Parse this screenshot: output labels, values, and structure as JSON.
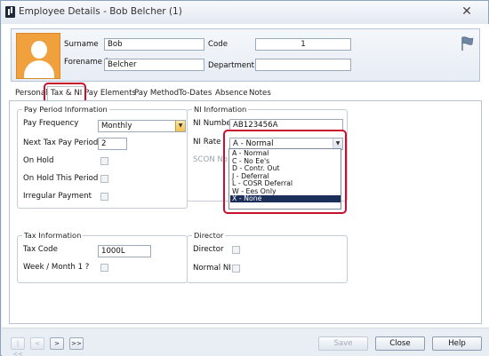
{
  "window": {
    "title": "Employee Details - Bob Belcher (1)",
    "close_glyph": "✕"
  },
  "header": {
    "surname_label": "Surname",
    "surname_value": "Bob",
    "forename_label": "Forename 1",
    "forename_value": "Belcher",
    "code_label": "Code",
    "code_value": "1",
    "department_label": "Department",
    "department_value": ""
  },
  "tabs": [
    "Personal",
    "Tax & NI",
    "Pay Elements",
    "Pay Method",
    "To-Dates",
    "Absence",
    "Notes"
  ],
  "pay_period": {
    "title": "Pay Period Information",
    "frequency_label": "Pay Frequency",
    "frequency_value": "Monthly",
    "next_period_label": "Next Tax Pay Period",
    "next_period_value": "2",
    "on_hold_label": "On Hold",
    "on_hold_period_label": "On Hold This Period",
    "irregular_label": "Irregular Payment"
  },
  "tax": {
    "title": "Tax Information",
    "code_label": "Tax Code",
    "code_value": "1000L",
    "week_month_label": "Week / Month 1 ?"
  },
  "ni": {
    "title": "NI Information",
    "number_label": "NI Number",
    "number_value": "AB123456A",
    "rate_label": "NI Rate",
    "rate_value": "A - Normal",
    "scon_label": "SCON No",
    "options": [
      "A - Normal",
      "C - No Ee's",
      "D - Contr. Out",
      "J - Deferral",
      "L - COSR Deferral",
      "W - Ees Only",
      "X - None"
    ],
    "selected_option": 6
  },
  "director": {
    "title": "Director",
    "director_label": "Director",
    "normal_ni_label": "Normal NI"
  },
  "footer": {
    "first": "|<<",
    "prev": "<",
    "next": ">",
    "last": ">>",
    "save": "Save",
    "close": "Close",
    "help": "Help"
  },
  "colors": {
    "highlight": "#c8102e",
    "selected_option_bg": "#1c2f59",
    "avatar": "#f0a03c"
  }
}
